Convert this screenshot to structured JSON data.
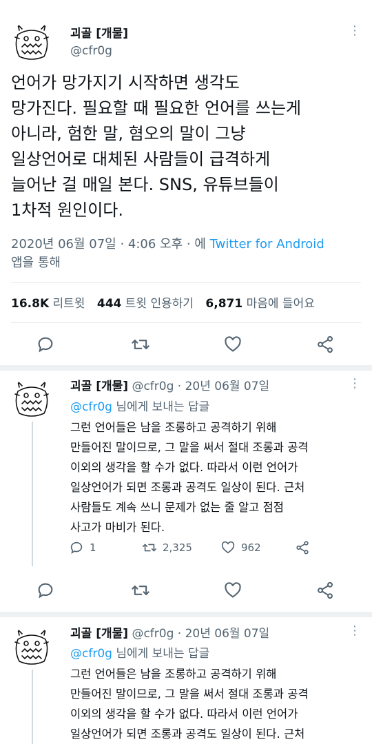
{
  "main_tweet": {
    "name": "괴골 [개물]",
    "handle": "@cfr0g",
    "text": "언어가 망가지기 시작하면 생각도\n망가진다. 필요할 때 필요한 언어를 쓰는게\n아니라, 험한 말, 혐오의 말이 그냥\n일상언어로 대체된 사람들이 급격하게\n늘어난 걸 매일 본다. SNS, 유튜브들이\n1차적 원인이다.",
    "date": "2020년 06월 07일 · 4:06 오후 · 에 ",
    "source_link": "Twitter for Android",
    "source_suffix": "앱을 통해",
    "stats": {
      "retweets_count": "16.8K",
      "retweets_label": "리트윗",
      "quotes_count": "444",
      "quotes_label": "트윗 인용하기",
      "likes_count": "6,871",
      "likes_label": "마음에 들어요"
    }
  },
  "replies": [
    {
      "name": "괴골 [개물]",
      "handle_date": "@cfr0g · 20년 06월 07일",
      "reply_to_handle": "@cfr0g",
      "reply_to_suffix": " 님에게 보내는 답글",
      "text": "그런 언어들은 남을 조롱하고 공격하기 위해\n만들어진 말이므로, 그 말을 써서 절대 조롱과 공격\n이외의 생각을 할 수가 없다. 따라서 이런 언어가\n일상언어가 되면 조롱과 공격도 일상이 된다. 근처\n사람들도 계속 쓰니 문제가 없는 줄 알고 점점\n사고가 마비가 된다.",
      "reply_count": "1",
      "retweet_count": "2,325",
      "like_count": "962"
    },
    {
      "name": "괴골 [개물]",
      "handle_date": "@cfr0g · 20년 06월 07일",
      "reply_to_handle": "@cfr0g",
      "reply_to_suffix": " 님에게 보내는 답글",
      "text": "그런 언어들은 남을 조롱하고 공격하기 위해\n만들어진 말이므로, 그 말을 써서 절대 조롱과 공격\n이외의 생각을 할 수가 없다. 따라서 이런 언어가\n일상언어가 되면 조롱과 공격도 일상이 된다. 근처\n사람들도 계속 쓰니 문제가 없는 줄 알고 점점"
    }
  ],
  "colors": {
    "link": "#1d9bf0",
    "secondary": "#536471",
    "primary": "#0f1419",
    "icon": "#536471"
  },
  "icons": [
    "more-icon",
    "reply-icon",
    "retweet-icon",
    "like-icon",
    "share-icon",
    "avatar-doodle"
  ]
}
